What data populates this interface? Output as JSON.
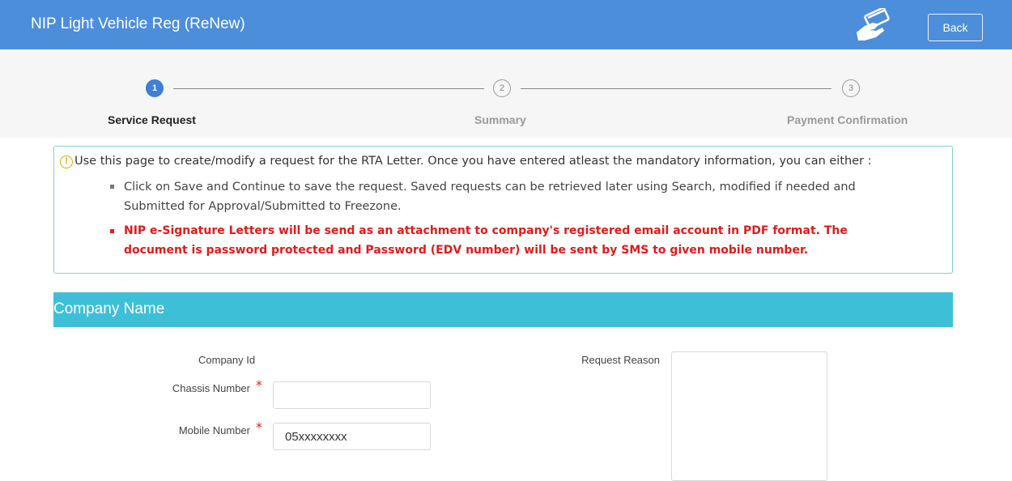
{
  "header": {
    "title": "NIP Light Vehicle Reg (ReNew)",
    "back_label": "Back",
    "icon": "hand-card-icon",
    "bg_color": "#4d8edb"
  },
  "steps": [
    {
      "number": "1",
      "label": "Service Request",
      "state": "active"
    },
    {
      "number": "2",
      "label": "Summary",
      "state": "inactive"
    },
    {
      "number": "3",
      "label": "Payment Confirmation",
      "state": "inactive"
    }
  ],
  "info": {
    "icon": "info-circle-icon",
    "intro": "Use this page to create/modify a request for the RTA Letter. Once you have entered atleast the mandatory information, you can either :",
    "bullet1_line1": "Click on Save and Continue to save the request. Saved requests can be retrieved later using Search, modified if needed and",
    "bullet1_line2": "Submitted for Approval/Submitted to Freezone.",
    "bullet2_line1": "NIP e-Signature Letters will be send as an attachment to company's registered email account in PDF format. The",
    "bullet2_line2": "document is password protected and Password (EDV number) will be sent by SMS to given mobile number.",
    "warning_color": "#e01b1b"
  },
  "section": {
    "title": "Company Name",
    "bg_color": "#3ebfd8"
  },
  "form": {
    "company_id_label": "Company Id",
    "chassis_label": "Chassis Number",
    "chassis_value": "",
    "mobile_label": "Mobile Number",
    "mobile_value": "05xxxxxxxx",
    "request_reason_label": "Request Reason",
    "required_mark": "*"
  }
}
